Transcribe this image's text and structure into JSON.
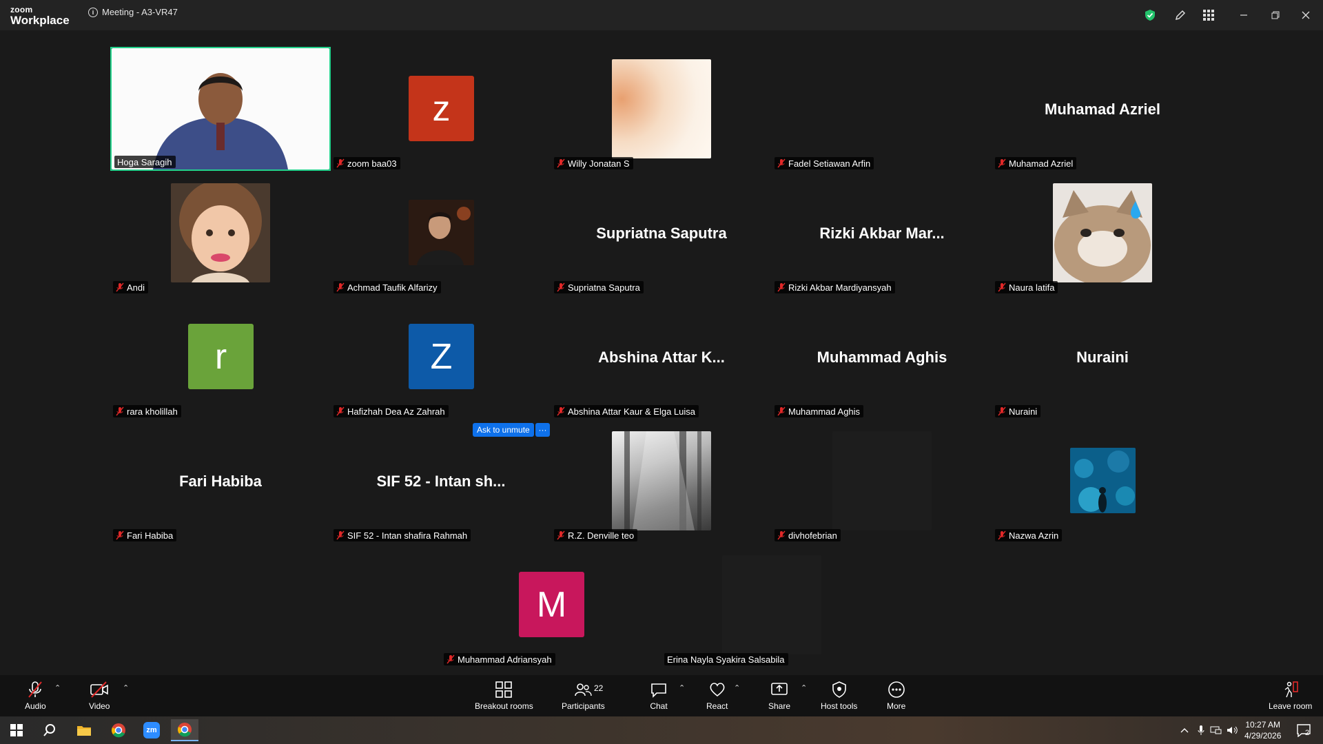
{
  "app": {
    "brand_small": "zoom",
    "brand_big": "Workplace",
    "meeting_title": "Meeting - A3-VR47"
  },
  "colors": {
    "active_border": "#23d18b",
    "accent": "#0e71eb",
    "muted_red": "#e02828"
  },
  "participants": [
    {
      "name": "Hoga Saragih",
      "type": "video"
    },
    {
      "name": "zoom baa03",
      "type": "letter",
      "letter": "z",
      "color": "#c4341a"
    },
    {
      "name": "Willy Jonatan S",
      "type": "photo"
    },
    {
      "name": "Fadel Setiawan Arfin",
      "type": "blank"
    },
    {
      "name": "Muhamad Azriel",
      "type": "text",
      "display": "Muhamad Azriel"
    },
    {
      "name": "Andi",
      "type": "photo"
    },
    {
      "name": "Achmad Taufik Alfarizy",
      "type": "photo"
    },
    {
      "name": "Supriatna Saputra",
      "type": "text",
      "display": "Supriatna Saputra"
    },
    {
      "name": "Rizki Akbar Mardiyansyah",
      "type": "text",
      "display": "Rizki Akbar Mar..."
    },
    {
      "name": "Naura latifa",
      "type": "photo"
    },
    {
      "name": "rara kholillah",
      "type": "letter",
      "letter": "r",
      "color": "#6aa33a"
    },
    {
      "name": "Hafizhah Dea Az Zahrah",
      "type": "letter",
      "letter": "Z",
      "color": "#0d5aa8"
    },
    {
      "name": "Abshina Attar Kaur & Elga Luisa",
      "type": "text",
      "display": "Abshina Attar K..."
    },
    {
      "name": "Muhammad Aghis",
      "type": "text",
      "display": "Muhammad Aghis"
    },
    {
      "name": "Nuraini",
      "type": "text",
      "display": "Nuraini"
    },
    {
      "name": "Fari Habiba",
      "type": "text",
      "display": "Fari Habiba"
    },
    {
      "name": "SIF 52 - Intan shafira Rahmah",
      "type": "text",
      "display": "SIF 52 - Intan sh..."
    },
    {
      "name": "R.Z. Denville teo",
      "type": "photo"
    },
    {
      "name": "divhofebrian",
      "type": "dark"
    },
    {
      "name": "Nazwa Azrin",
      "type": "photo"
    },
    {
      "name": "Muhammad Adriansyah",
      "type": "letter",
      "letter": "M",
      "color": "#c8175c"
    },
    {
      "name": "Erina Nayla Syakira Salsabila",
      "type": "dark"
    }
  ],
  "popup": {
    "ask_unmute": "Ask to unmute",
    "more": "···"
  },
  "toolbar": {
    "audio": "Audio",
    "video": "Video",
    "breakout": "Breakout rooms",
    "participants": "Participants",
    "participants_count": "22",
    "chat": "Chat",
    "react": "React",
    "share": "Share",
    "host_tools": "Host tools",
    "more": "More",
    "leave": "Leave room"
  },
  "taskbar": {
    "time": "10:27 AM",
    "date": "4/29/2026",
    "notif_count": "2"
  }
}
